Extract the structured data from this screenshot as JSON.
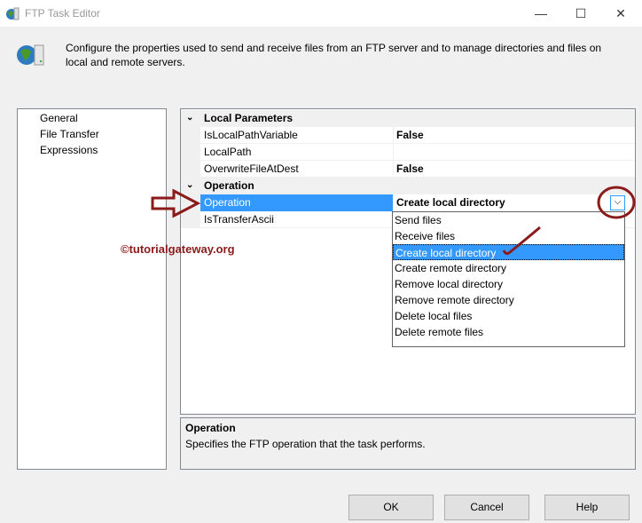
{
  "window": {
    "title": "FTP Task Editor",
    "icon": "ftp-globe-server-icon"
  },
  "description": "Configure the properties used to send and receive files from an FTP server and to manage directories and files on local and remote servers.",
  "nav": [
    {
      "label": "General"
    },
    {
      "label": "File Transfer"
    },
    {
      "label": "Expressions"
    }
  ],
  "grid": {
    "categories": [
      {
        "label": "Local Parameters",
        "properties": [
          {
            "name": "IsLocalPathVariable",
            "value": "False"
          },
          {
            "name": "LocalPath",
            "value": ""
          },
          {
            "name": "OverwriteFileAtDest",
            "value": "False"
          }
        ]
      },
      {
        "label": "Operation",
        "properties": [
          {
            "name": "Operation",
            "value": "Create local directory"
          },
          {
            "name": "IsTransferAscii",
            "value": ""
          }
        ]
      }
    ]
  },
  "dropdown": {
    "options": [
      "Send files",
      "Receive files",
      "Create local directory",
      "Create remote directory",
      "Remove local directory",
      "Remove remote directory",
      "Delete local files",
      "Delete remote files"
    ],
    "selected": "Create local directory"
  },
  "help": {
    "title": "Operation",
    "text": "Specifies the FTP operation that the task performs."
  },
  "buttons": {
    "ok": "OK",
    "cancel": "Cancel",
    "help": "Help"
  },
  "watermark": "©tutorialgateway.org",
  "colors": {
    "selection": "#3399ff",
    "annotation": "#8b1a1a"
  }
}
